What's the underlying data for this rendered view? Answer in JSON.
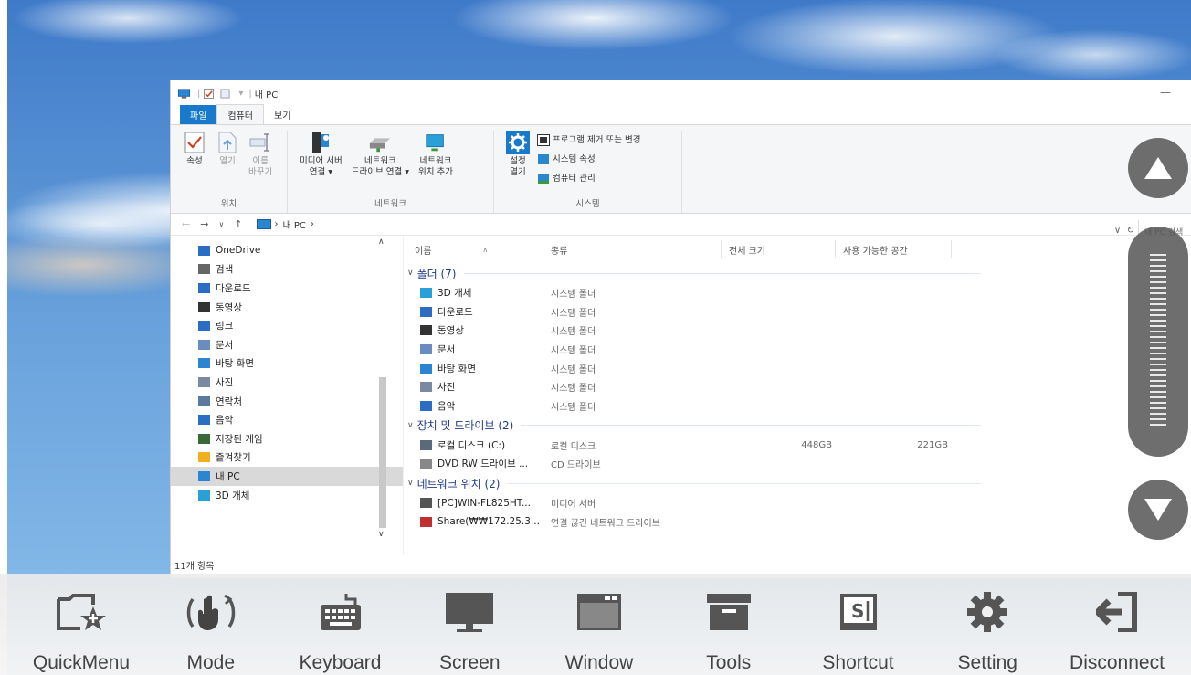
{
  "explorer": {
    "title": "내 PC",
    "ribbon_tabs": [
      "파일",
      "컴퓨터",
      "보기"
    ],
    "ribbon": {
      "location_group": {
        "label": "위치",
        "buttons": [
          "속성",
          "열기",
          "이름\n바꾸기"
        ]
      },
      "network_group": {
        "label": "네트워크",
        "buttons": [
          "미디어 서버\n연결 ▾",
          "네트워크\n드라이브 연결 ▾",
          "네트워크\n위치 추가"
        ]
      },
      "system_group": {
        "label": "시스템",
        "settings_button": "설정\n열기",
        "small_buttons": [
          "프로그램 제거 또는 변경",
          "시스템 속성",
          "컴퓨터 관리"
        ]
      }
    },
    "address": {
      "path": [
        "내 PC"
      ],
      "search_placeholder": "내 PC 검색"
    },
    "nav_pane": [
      {
        "label": "OneDrive",
        "icon": "cloud-icon",
        "color": "#2b6cc4"
      },
      {
        "label": "검색",
        "icon": "search-icon",
        "color": "#666666"
      },
      {
        "label": "다운로드",
        "icon": "download-icon",
        "color": "#2b6cc4"
      },
      {
        "label": "동영상",
        "icon": "video-icon",
        "color": "#333333"
      },
      {
        "label": "링크",
        "icon": "link-icon",
        "color": "#2b6cc4"
      },
      {
        "label": "문서",
        "icon": "document-icon",
        "color": "#6a8cbf"
      },
      {
        "label": "바탕 화면",
        "icon": "desktop-icon",
        "color": "#2a86d0"
      },
      {
        "label": "사진",
        "icon": "picture-icon",
        "color": "#7a8aa0"
      },
      {
        "label": "연락처",
        "icon": "contacts-icon",
        "color": "#5a7aa0"
      },
      {
        "label": "음악",
        "icon": "music-icon",
        "color": "#2b6cc4"
      },
      {
        "label": "저장된 게임",
        "icon": "game-icon",
        "color": "#3a6a3a"
      },
      {
        "label": "즐겨찾기",
        "icon": "star-icon",
        "color": "#f0b020"
      },
      {
        "label": "내 PC",
        "icon": "pc-icon",
        "color": "#2a86d0",
        "selected": true
      },
      {
        "label": "3D 개체",
        "icon": "3d-object-icon",
        "color": "#2aa0d8"
      }
    ],
    "status": "11개 항목",
    "columns": [
      "이름",
      "종류",
      "전체 크기",
      "사용 가능한 공간"
    ],
    "groups": [
      {
        "title": "폴더 (7)",
        "items": [
          {
            "name": "3D 개체",
            "type": "시스템 폴더",
            "total": "",
            "free": "",
            "icon": "3d-object-icon",
            "color": "#2aa0d8"
          },
          {
            "name": "다운로드",
            "type": "시스템 폴더",
            "total": "",
            "free": "",
            "icon": "download-icon",
            "color": "#2b6cc4"
          },
          {
            "name": "동영상",
            "type": "시스템 폴더",
            "total": "",
            "free": "",
            "icon": "video-icon",
            "color": "#333333"
          },
          {
            "name": "문서",
            "type": "시스템 폴더",
            "total": "",
            "free": "",
            "icon": "document-icon",
            "color": "#6a8cbf"
          },
          {
            "name": "바탕 화면",
            "type": "시스템 폴더",
            "total": "",
            "free": "",
            "icon": "desktop-icon",
            "color": "#2a86d0"
          },
          {
            "name": "사진",
            "type": "시스템 폴더",
            "total": "",
            "free": "",
            "icon": "picture-icon",
            "color": "#7a8aa0"
          },
          {
            "name": "음악",
            "type": "시스템 폴더",
            "total": "",
            "free": "",
            "icon": "music-icon",
            "color": "#2b6cc4"
          }
        ]
      },
      {
        "title": "장치 및 드라이브 (2)",
        "items": [
          {
            "name": "로컬 디스크 (C:)",
            "type": "로컬 디스크",
            "total": "448GB",
            "free": "221GB",
            "icon": "drive-icon",
            "color": "#5a6a7a"
          },
          {
            "name": "DVD RW 드라이브 ...",
            "type": "CD 드라이브",
            "total": "",
            "free": "",
            "icon": "dvd-icon",
            "color": "#888888"
          }
        ]
      },
      {
        "title": "네트워크 위치 (2)",
        "items": [
          {
            "name": "[PC]WIN-FL825HT...",
            "type": "미디어 서버",
            "total": "",
            "free": "",
            "icon": "media-server-icon",
            "color": "#555555"
          },
          {
            "name": "Share(₩₩172.25.3...",
            "type": "연결 끊긴 네트워크 드라이브",
            "total": "",
            "free": "",
            "icon": "network-drive-icon",
            "color": "#c03030"
          }
        ]
      }
    ]
  },
  "toolbar": {
    "items": [
      {
        "label": "QuickMenu",
        "icon": "quickmenu-icon"
      },
      {
        "label": "Mode",
        "icon": "touch-mode-icon"
      },
      {
        "label": "Keyboard",
        "icon": "keyboard-icon"
      },
      {
        "label": "Screen",
        "icon": "monitor-icon"
      },
      {
        "label": "Window",
        "icon": "window-icon"
      },
      {
        "label": "Tools",
        "icon": "toolbox-icon"
      },
      {
        "label": "Shortcut",
        "icon": "shortcut-icon"
      },
      {
        "label": "Setting",
        "icon": "gear-icon"
      },
      {
        "label": "Disconnect",
        "icon": "disconnect-icon"
      }
    ]
  },
  "colors": {
    "accent": "#1979ca",
    "group_header": "#1e3a8a",
    "toolbar_icon": "#555555",
    "overlay_button": "#555555"
  }
}
